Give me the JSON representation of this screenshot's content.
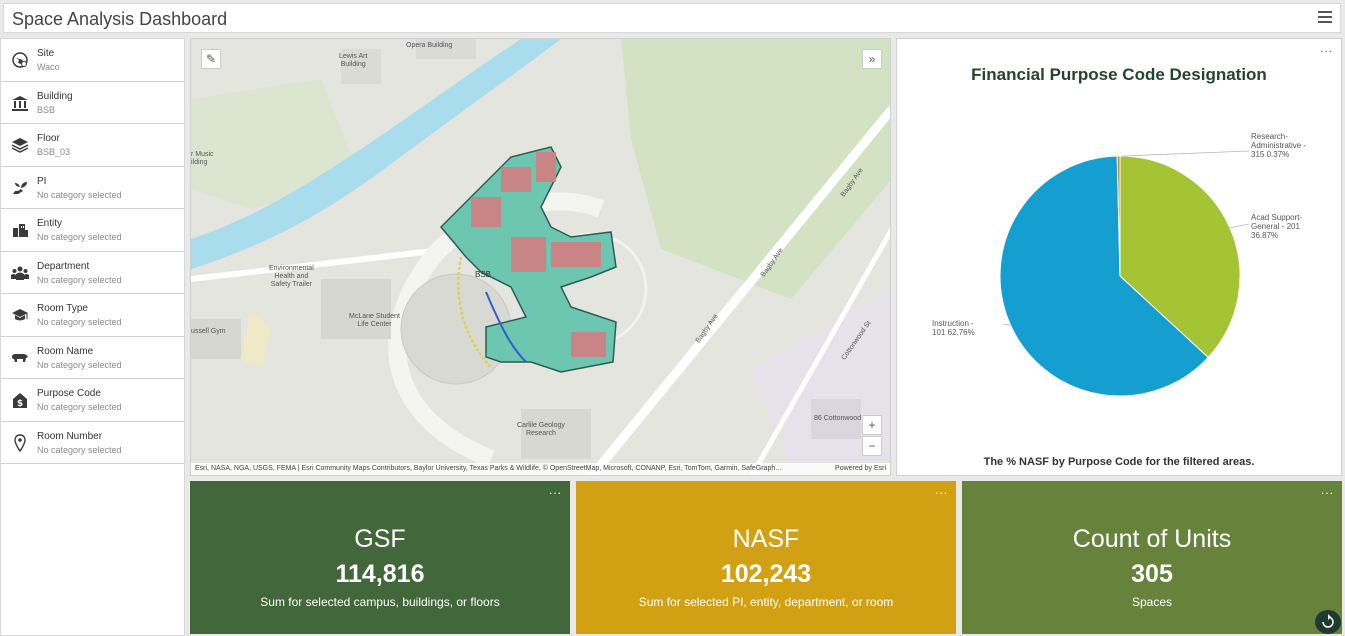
{
  "app": {
    "title": "Space Analysis Dashboard"
  },
  "sidebar": {
    "items": [
      {
        "label": "Site",
        "value": "Waco",
        "icon": "site-icon"
      },
      {
        "label": "Building",
        "value": "BSB",
        "icon": "building-icon"
      },
      {
        "label": "Floor",
        "value": "BSB_03",
        "icon": "layers-icon"
      },
      {
        "label": "PI",
        "value": "No category selected",
        "icon": "hand-plant-icon"
      },
      {
        "label": "Entity",
        "value": "No category selected",
        "icon": "buildings-icon"
      },
      {
        "label": "Department",
        "value": "No category selected",
        "icon": "group-icon"
      },
      {
        "label": "Room Type",
        "value": "No category selected",
        "icon": "graduation-cap-icon"
      },
      {
        "label": "Room Name",
        "value": "No category selected",
        "icon": "bear-icon"
      },
      {
        "label": "Purpose Code",
        "value": "No category selected",
        "icon": "money-house-icon"
      },
      {
        "label": "Room Number",
        "value": "No category selected",
        "icon": "location-pin-icon"
      }
    ]
  },
  "map": {
    "labels": {
      "opera": "Opera Building",
      "lewis": "Lewis Art\nBuilding",
      "music": "r Music\nilding",
      "env": "Environmental\nHealth and\nSafety Trailer",
      "mclane": "McLane Student\nLife Center",
      "russell": "ussell Gym",
      "carlile": "Carlile Geology\nResearch",
      "cottonwood": "86 Cottonwood",
      "bagby1": "Bagby Ave",
      "bagby2": "Bagby Ave",
      "bagby3": "Bagby Ave",
      "cottonwood_st": "Cottonwood St",
      "bsb": "BSB"
    },
    "zoom_in": "+",
    "zoom_out": "−",
    "attribution": "Esri, NASA, NGA, USGS, FEMA | Esri Community Maps Contributors, Baylor University, Texas Parks & Wildlife, © OpenStreetMap, Microsoft, CONANP, Esri, TomTom, Garmin, SafeGraph…",
    "powered_by": "Powered by Esri",
    "colors": {
      "water": "#a9dcec",
      "grass": "#d6e3c7",
      "building_room": "#c98585",
      "corridor": "#6cc6b0"
    }
  },
  "pie": {
    "title": "Financial Purpose Code Designation",
    "footer": "The % NASF by Purpose Code for the filtered areas.",
    "menu": "...",
    "chart_data": {
      "type": "pie",
      "title": "Financial Purpose Code Designation",
      "slices": [
        {
          "label": "Instruction - 101",
          "percent": 62.76,
          "color": "#159fd1",
          "text": "Instruction -\n101 62.76%"
        },
        {
          "label": "Acad Support-General - 201",
          "percent": 36.87,
          "color": "#a4c436",
          "text": "Acad Support-\nGeneral - 201\n36.87%"
        },
        {
          "label": "Research-Administrative - 315",
          "percent": 0.37,
          "color": "#c17a4a",
          "text": "Research-\nAdministrative -\n315 0.37%"
        }
      ]
    }
  },
  "cards": [
    {
      "title": "GSF",
      "value": "114,816",
      "subtitle": "Sum for selected campus, buildings, or floors",
      "color": "#42673a",
      "menu": "..."
    },
    {
      "title": "NASF",
      "value": "102,243",
      "subtitle": "Sum for selected PI, entity, department, or room",
      "color": "#d1a013",
      "menu": "..."
    },
    {
      "title": "Count of Units",
      "value": "305",
      "subtitle": "Spaces",
      "color": "#66823b",
      "menu": "..."
    }
  ]
}
